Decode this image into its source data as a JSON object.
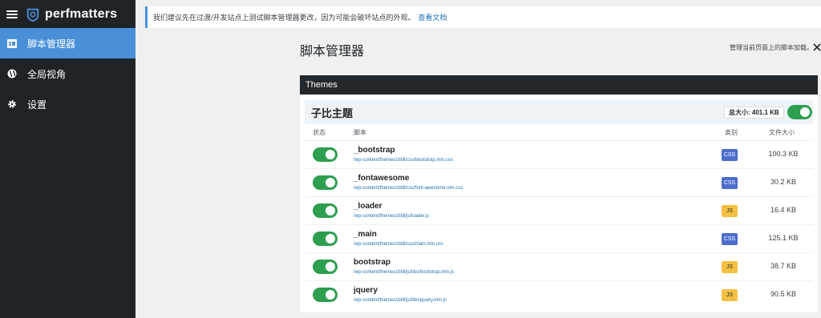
{
  "sidebar": {
    "logo": "perfmatters",
    "items": [
      {
        "label": "脚本管理器",
        "icon": "dashboard-icon",
        "active": true
      },
      {
        "label": "全局视角",
        "icon": "globe-icon",
        "active": false
      },
      {
        "label": "设置",
        "icon": "gear-icon",
        "active": false
      }
    ]
  },
  "notice": {
    "text": "我们建议先在过渡/开发站点上测试脚本管理器更改，因为可能会破坏站点的外观。",
    "link": "查看文档"
  },
  "page": {
    "title": "脚本管理器",
    "description": "管理当前页面上的脚本加载。"
  },
  "section": {
    "title": "Themes"
  },
  "group": {
    "title": "子比主题",
    "total_size": "总大小: 401.1 KB",
    "enabled": true
  },
  "columns": {
    "status": "状态",
    "script": "脚本",
    "type": "类别",
    "size": "文件大小"
  },
  "scripts": [
    {
      "name": "_bootstrap",
      "path": "/wp-content/themes/zibll/css/bootstrap.min.css",
      "type": "CSS",
      "size": "100.3 KB",
      "enabled": true
    },
    {
      "name": "_fontawesome",
      "path": "/wp-content/themes/zibll/css/font-awesome.min.css",
      "type": "CSS",
      "size": "30.2 KB",
      "enabled": true
    },
    {
      "name": "_loader",
      "path": "/wp-content/themes/zibll/js/loader.js",
      "type": "JS",
      "size": "16.4 KB",
      "enabled": true
    },
    {
      "name": "_main",
      "path": "/wp-content/themes/zibll/css/main.min.css",
      "type": "CSS",
      "size": "125.1 KB",
      "enabled": true
    },
    {
      "name": "bootstrap",
      "path": "/wp-content/themes/zibll/js/libs/bootstrap.min.js",
      "type": "JS",
      "size": "38.7 KB",
      "enabled": true
    },
    {
      "name": "jquery",
      "path": "/wp-content/themes/zibll/js/libs/jquery.min.js",
      "type": "JS",
      "size": "90.5 KB",
      "enabled": true
    }
  ],
  "colors": {
    "accent": "#4a90d9",
    "toggle_on": "#2e9e4f",
    "css_badge": "#4d6dcb",
    "js_badge": "#f4c042",
    "sidebar_bg": "#1e2327"
  }
}
